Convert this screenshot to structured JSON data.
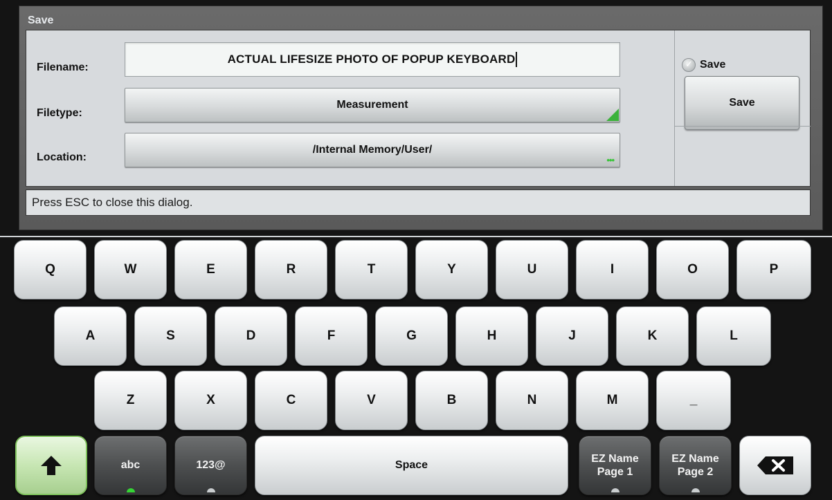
{
  "dialog": {
    "title": "Save",
    "filename_label": "Filename:",
    "filename_value": "ACTUAL LIFESIZE PHOTO OF POPUP KEYBOARD",
    "filetype_label": "Filetype:",
    "filetype_value": "Measurement",
    "location_label": "Location:",
    "location_value": "/Internal Memory/User/",
    "save_radio_label": "Save",
    "save_button_label": "Save",
    "status_text": "Press ESC to close this dialog.",
    "accent_color": "#3bb23b"
  },
  "keyboard": {
    "row1": [
      "Q",
      "W",
      "E",
      "R",
      "T",
      "Y",
      "U",
      "I",
      "O",
      "P"
    ],
    "row2": [
      "A",
      "S",
      "D",
      "F",
      "G",
      "H",
      "J",
      "K",
      "L"
    ],
    "row3": [
      "Z",
      "X",
      "C",
      "V",
      "B",
      "N",
      "M",
      "_"
    ],
    "bottom": {
      "shift_icon": "shift-arrow-icon",
      "abc": "abc",
      "num_sym": "123@",
      "space": "Space",
      "ez_page1": "EZ Name\nPage 1",
      "ez_page2": "EZ Name\nPage 2",
      "backspace_icon": "backspace-icon"
    }
  }
}
